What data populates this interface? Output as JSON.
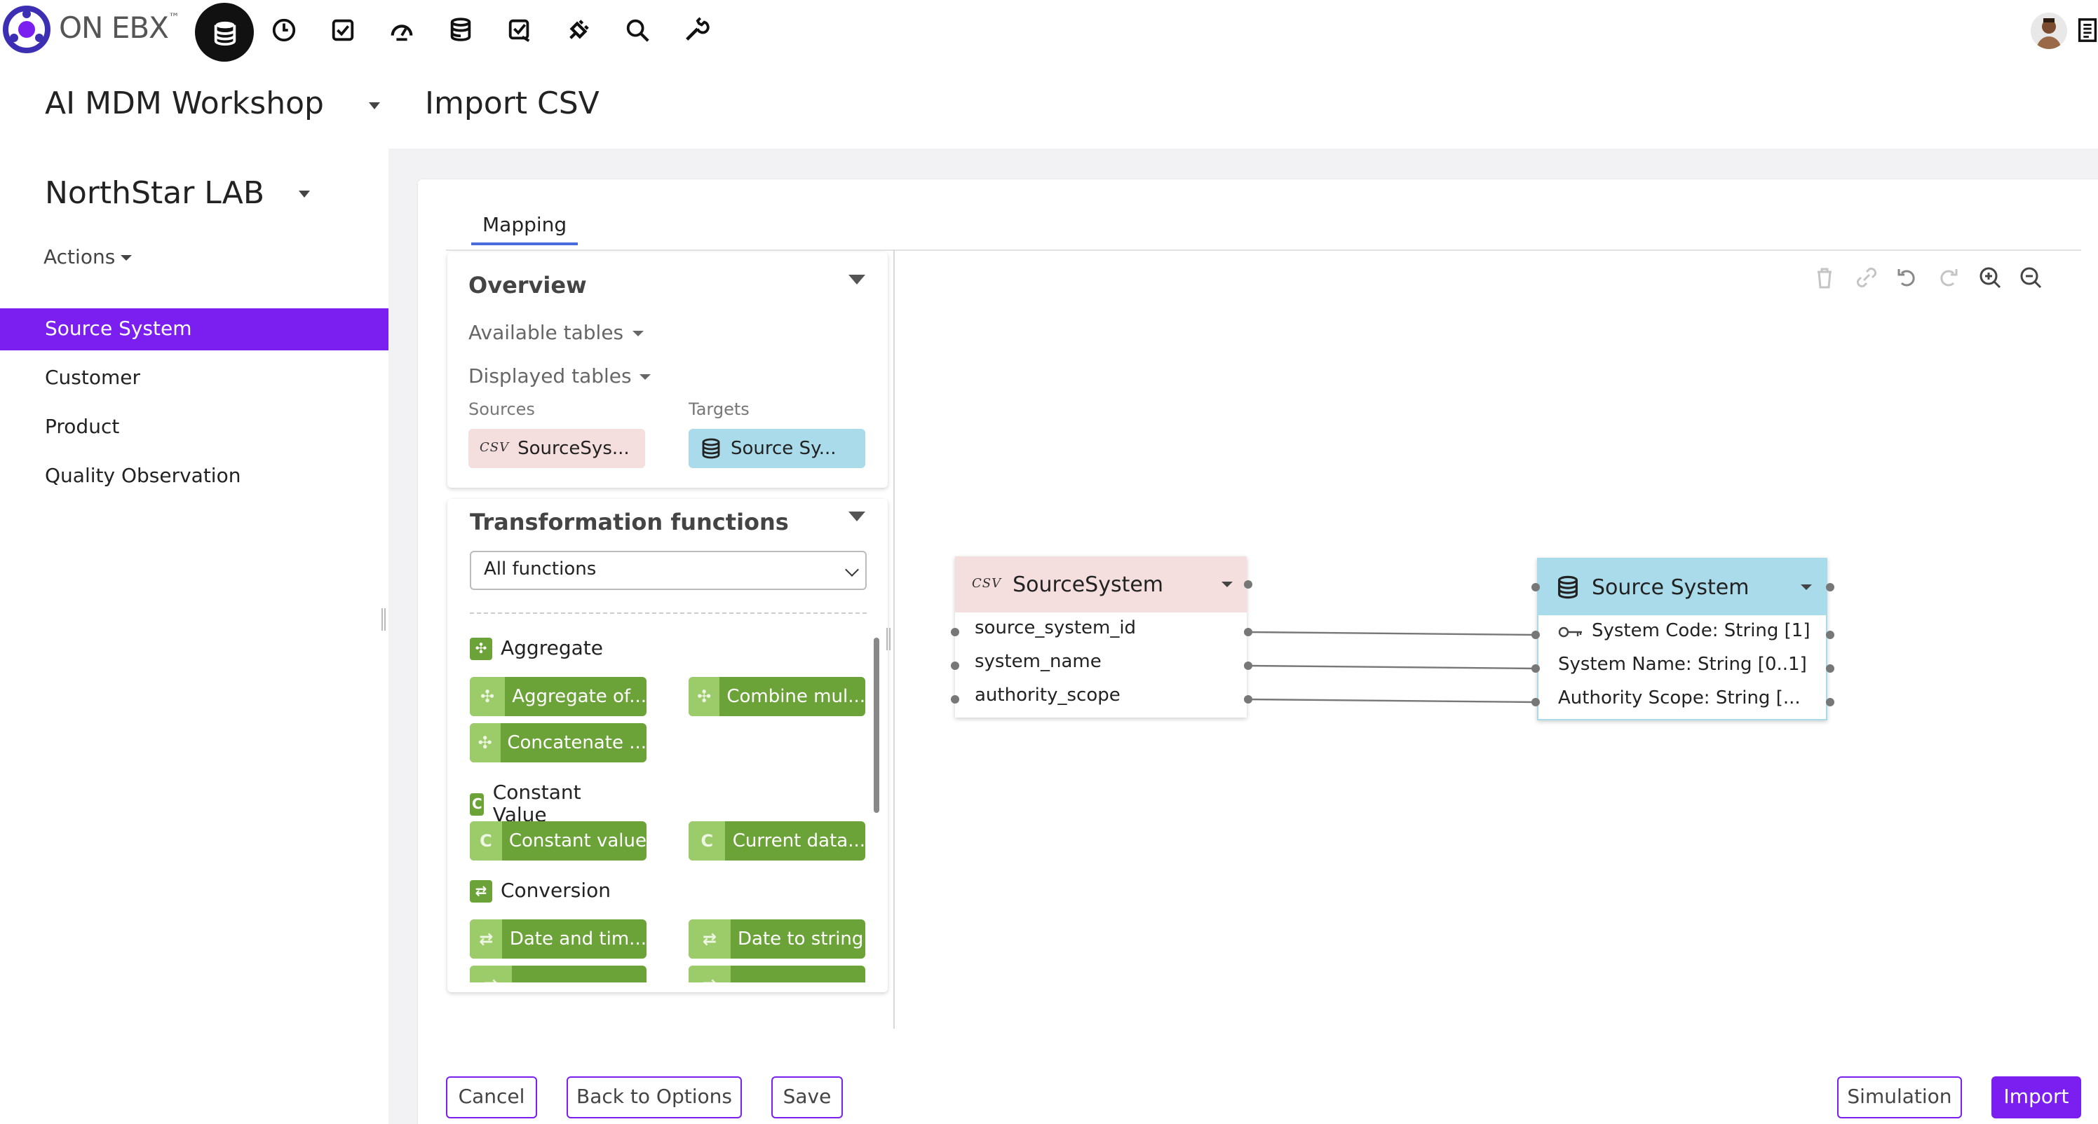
{
  "app": {
    "logo_text": "ON EBX",
    "logo_tm": "™"
  },
  "nav_icons": [
    "database-icon",
    "history-icon",
    "tasks-icon",
    "dashboard-icon",
    "datasets-icon",
    "workflow-icon",
    "plugin-icon",
    "search-icon",
    "tools-icon"
  ],
  "header": {
    "workspace": "AI MDM Workshop",
    "page_title": "Import CSV"
  },
  "sidebar": {
    "dataspace": "NorthStar LAB",
    "actions_label": "Actions",
    "items": [
      {
        "label": "Source System",
        "active": true
      },
      {
        "label": "Customer",
        "active": false
      },
      {
        "label": "Product",
        "active": false
      },
      {
        "label": "Quality Observation",
        "active": false
      }
    ]
  },
  "tabs": {
    "mapping": "Mapping"
  },
  "overview": {
    "title": "Overview",
    "available_tables": "Available tables",
    "displayed_tables": "Displayed tables",
    "sources_label": "Sources",
    "targets_label": "Targets",
    "source_chip": "SourceSys...",
    "source_badge": "CSV",
    "target_chip": "Source Sy..."
  },
  "transformations": {
    "title": "Transformation functions",
    "filter_value": "All functions",
    "groups": [
      {
        "title": "Aggregate",
        "icon": "move-icon",
        "functions": [
          "Aggregate of...",
          "Combine mul...",
          "Concatenate ..."
        ]
      },
      {
        "title": "Constant Value",
        "icon": "C",
        "functions": [
          "Constant value",
          "Current data..."
        ]
      },
      {
        "title": "Conversion",
        "icon": "swap-icon",
        "functions": [
          "Date and tim...",
          "Date to string"
        ]
      }
    ]
  },
  "diagram": {
    "source": {
      "badge": "CSV",
      "title": "SourceSystem",
      "fields": [
        "source_system_id",
        "system_name",
        "authority_scope"
      ]
    },
    "target": {
      "title": "Source System",
      "fields": [
        "System Code: String [1]",
        "System Name: String [0..1]",
        "Authority Scope: String [..."
      ]
    }
  },
  "buttons": {
    "cancel": "Cancel",
    "back": "Back to Options",
    "save": "Save",
    "simulation": "Simulation",
    "import": "Import"
  },
  "colors": {
    "accent": "#7a1ff0",
    "function_green": "#6ca339",
    "source_pink": "#f4dede",
    "target_blue": "#a9dbea"
  }
}
